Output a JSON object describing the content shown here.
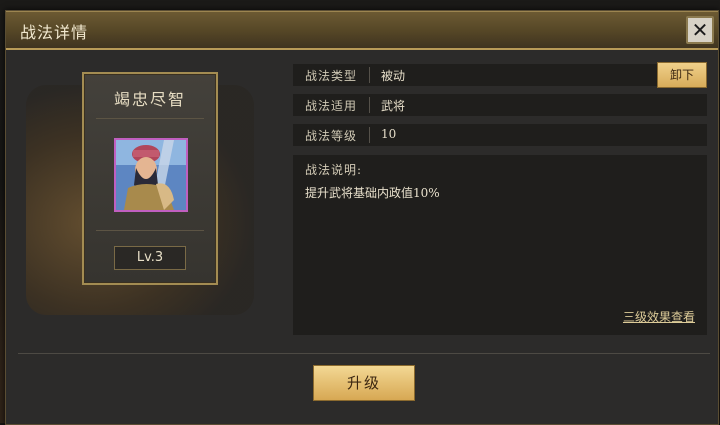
{
  "dialog": {
    "title": "战法详情"
  },
  "skill_card": {
    "name": "竭忠尽智",
    "level": "Lv.3"
  },
  "info_rows": [
    {
      "label": "战法类型",
      "value": "被动"
    },
    {
      "label": "战法适用",
      "value": "武将"
    },
    {
      "label": "战法等级",
      "value": "10"
    }
  ],
  "unequip_label": "卸下",
  "description": {
    "title": "战法说明:",
    "text": "提升武将基础内政值10%",
    "link": "三级效果查看"
  },
  "upgrade_label": "升级",
  "icons": {
    "close": "close-icon",
    "portrait": "general-portrait"
  },
  "colors": {
    "accent_gold": "#d7a853",
    "title_bar": "#554626",
    "portrait_border": "#c05fc0"
  }
}
